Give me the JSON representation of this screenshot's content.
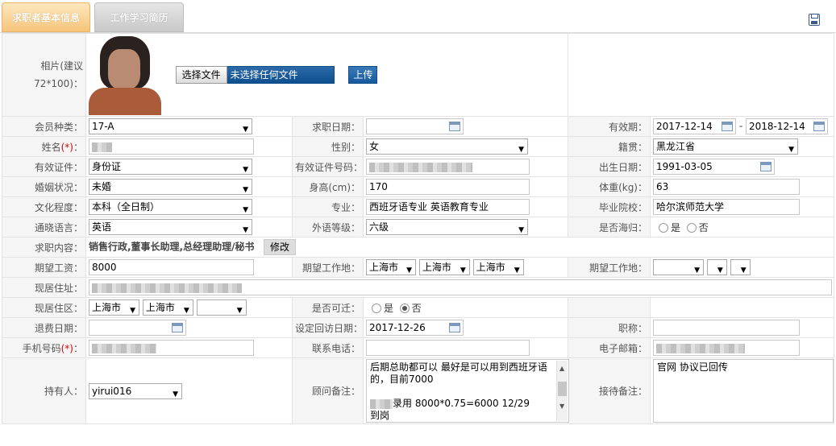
{
  "tabs": [
    {
      "label": "求职者基本信息",
      "active": true
    },
    {
      "label": "工作学习简历",
      "active": false
    }
  ],
  "toolbar": {
    "save_icon": "save-icon"
  },
  "photo": {
    "label": "相片(建议72*100)：",
    "choose_button": "选择文件",
    "file_status": "未选择任何文件",
    "upload_button": "上传"
  },
  "fields": {
    "member_type": {
      "label": "会员种类：",
      "value": "17-A"
    },
    "apply_date": {
      "label": "求职日期：",
      "value": ""
    },
    "valid_period": {
      "label": "有效期：",
      "from": "2017-12-14",
      "sep": "-",
      "to": "2018-12-14"
    },
    "name": {
      "label": "姓名",
      "required": "(*)",
      "suffix": "："
    },
    "gender": {
      "label": "性别：",
      "value": "女"
    },
    "native_place": {
      "label": "籍贯：",
      "value": "黑龙江省"
    },
    "id_type": {
      "label": "有效证件：",
      "value": "身份证"
    },
    "id_number": {
      "label": "有效证件号码："
    },
    "birth_date": {
      "label": "出生日期：",
      "value": "1991-03-05"
    },
    "marital": {
      "label": "婚姻状况：",
      "value": "未婚"
    },
    "height": {
      "label": "身高(cm)：",
      "value": "170"
    },
    "weight": {
      "label": "体重(kg)：",
      "value": "63"
    },
    "education": {
      "label": "文化程度：",
      "value": "本科（全日制）"
    },
    "major": {
      "label": "专业：",
      "value": "西班牙语专业  英语教育专业"
    },
    "school": {
      "label": "毕业院校：",
      "value": "哈尔滨师范大学"
    },
    "language": {
      "label": "通晓语言：",
      "value": "英语"
    },
    "foreign_level": {
      "label": "外语等级：",
      "value": "六级"
    },
    "returnee": {
      "label": "是否海归：",
      "yes": "是",
      "no": "否"
    },
    "job_content": {
      "label": "求职内容：",
      "value": "销售行政,董事长助理,总经理助理/秘书",
      "edit_button": "修改"
    },
    "salary": {
      "label": "期望工资：",
      "value": "8000"
    },
    "expect_place1": {
      "label": "期望工作地：",
      "values": [
        "上海市",
        "上海市",
        "上海市"
      ]
    },
    "expect_place2": {
      "label": "期望工作地：",
      "values": [
        "",
        "",
        ""
      ]
    },
    "address": {
      "label": "现居住址："
    },
    "district": {
      "label": "现居住区：",
      "values": [
        "上海市",
        "上海市",
        ""
      ]
    },
    "relocate": {
      "label": "是否可迁：",
      "yes": "是",
      "no": "否",
      "selected": "否"
    },
    "refund_date": {
      "label": "退费日期：",
      "value": ""
    },
    "revisit_date": {
      "label": "设定回访日期：",
      "value": "2017-12-26"
    },
    "title": {
      "label": "职称：",
      "value": ""
    },
    "mobile": {
      "label": "手机号码",
      "required": "(*)",
      "suffix": "："
    },
    "phone": {
      "label": "联系电话：",
      "value": ""
    },
    "email": {
      "label": "电子邮箱："
    },
    "holder": {
      "label": "持有人：",
      "value": "yirui016"
    },
    "consultant_note": {
      "label": "顾问备注：",
      "line1": "后期总助都可以 最好是可以用到西班牙语的，目前7000",
      "line3_suffix": "录用  8000*0.75=6000   12/29",
      "line4": "到岗"
    },
    "reception_note": {
      "label": "接待备注：",
      "value": "官网 协议已回传"
    }
  }
}
